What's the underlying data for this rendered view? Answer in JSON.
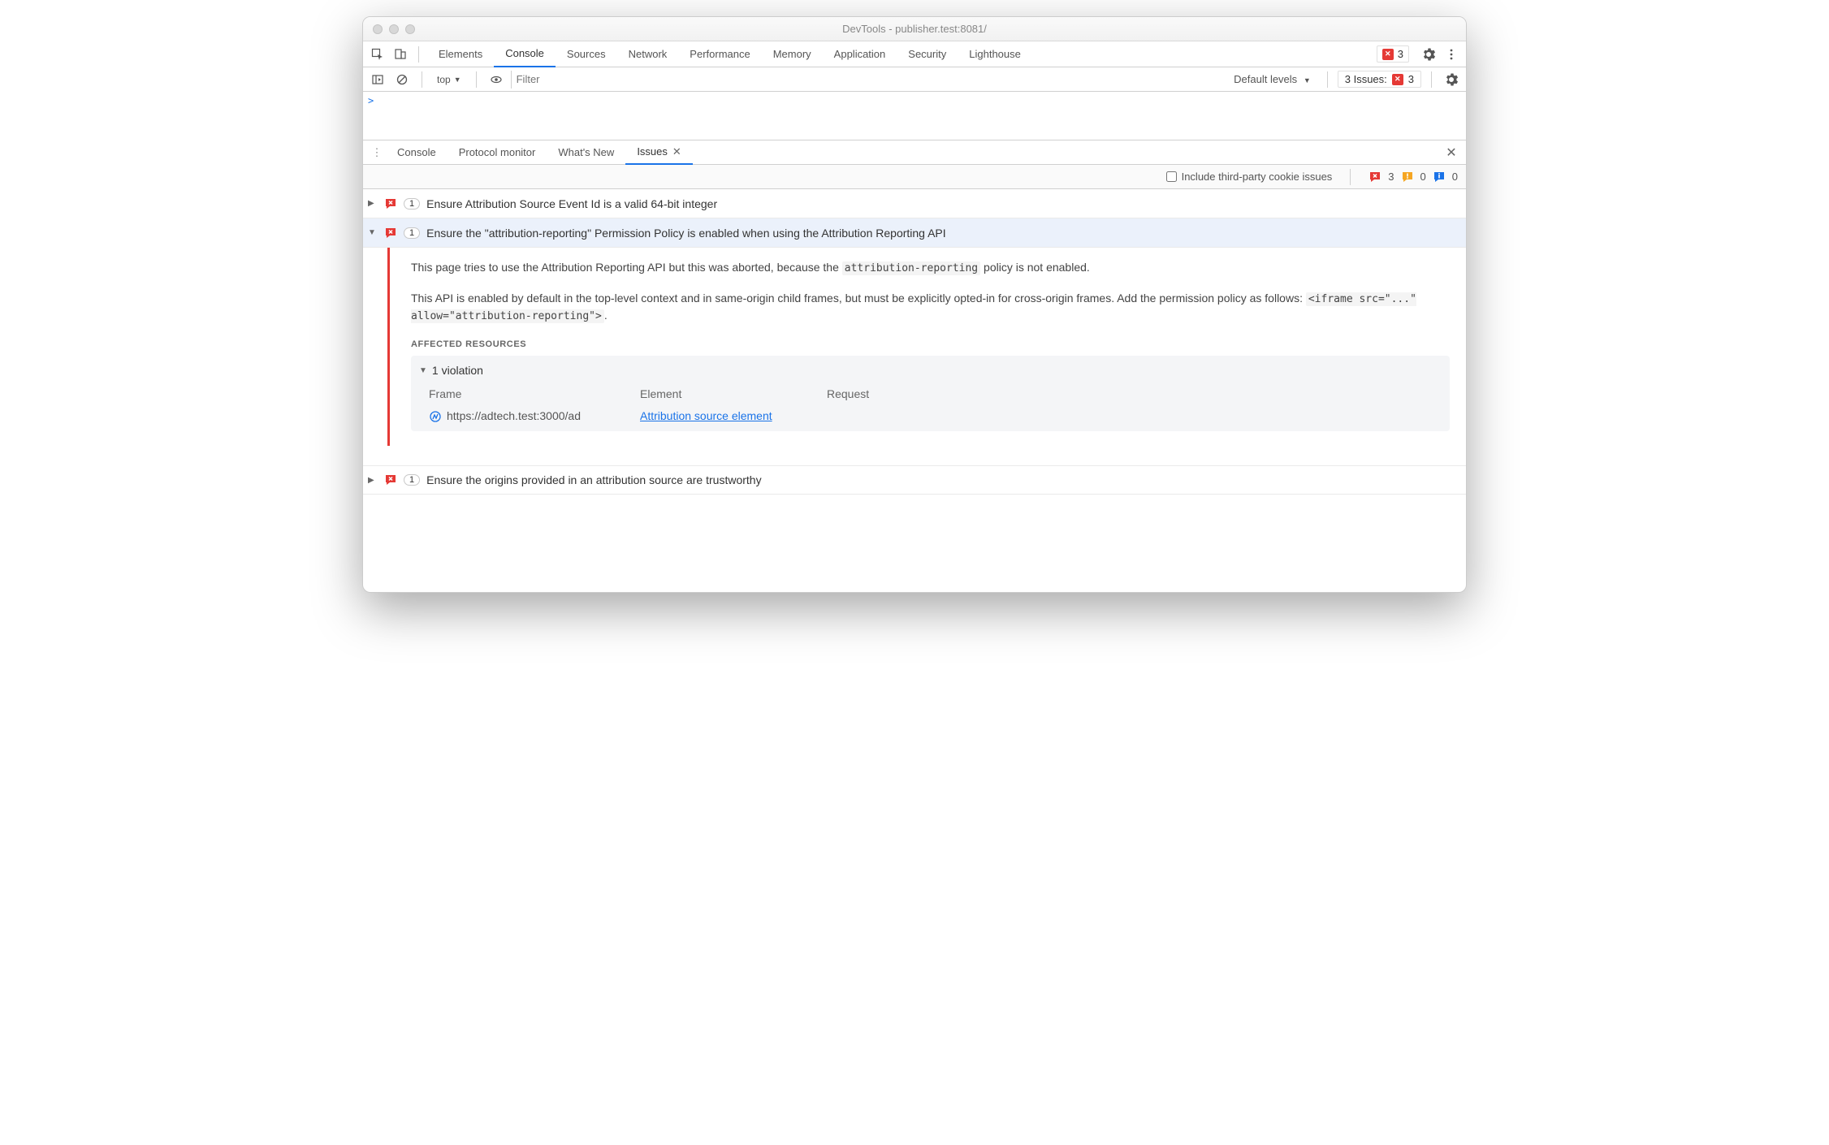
{
  "window_title": "DevTools - publisher.test:8081/",
  "tabs": [
    "Elements",
    "Console",
    "Sources",
    "Network",
    "Performance",
    "Memory",
    "Application",
    "Security",
    "Lighthouse"
  ],
  "active_tab": "Console",
  "top_error_count": "3",
  "console": {
    "context": "top",
    "filter_placeholder": "Filter",
    "levels": "Default levels",
    "issues_label": "3 Issues:",
    "issues_count": "3",
    "prompt": ">"
  },
  "drawer": {
    "tabs": [
      "Console",
      "Protocol monitor",
      "What's New",
      "Issues"
    ],
    "active": "Issues"
  },
  "issues_bar": {
    "checkbox_label": "Include third-party cookie issues",
    "errors": "3",
    "warnings": "0",
    "infos": "0"
  },
  "issues": [
    {
      "count": "1",
      "title": "Ensure Attribution Source Event Id is a valid 64-bit integer",
      "expanded": false
    },
    {
      "count": "1",
      "title": "Ensure the \"attribution-reporting\" Permission Policy is enabled when using the Attribution Reporting API",
      "expanded": true,
      "body": {
        "p1_pre": "This page tries to use the Attribution Reporting API but this was aborted, because the ",
        "p1_code": "attribution-reporting",
        "p1_post": " policy is not enabled.",
        "p2_pre": "This API is enabled by default in the top-level context and in same-origin child frames, but must be explicitly opted-in for cross-origin frames. Add the permission policy as follows: ",
        "p2_code": "<iframe src=\"...\" allow=\"attribution-reporting\">",
        "p2_post": ".",
        "section": "AFFECTED RESOURCES",
        "violation_label": "1 violation",
        "cols": {
          "frame": "Frame",
          "element": "Element",
          "request": "Request"
        },
        "frame_url": "https://adtech.test:3000/ad",
        "element_link": "Attribution source element"
      }
    },
    {
      "count": "1",
      "title": "Ensure the origins provided in an attribution source are trustworthy",
      "expanded": false
    }
  ]
}
